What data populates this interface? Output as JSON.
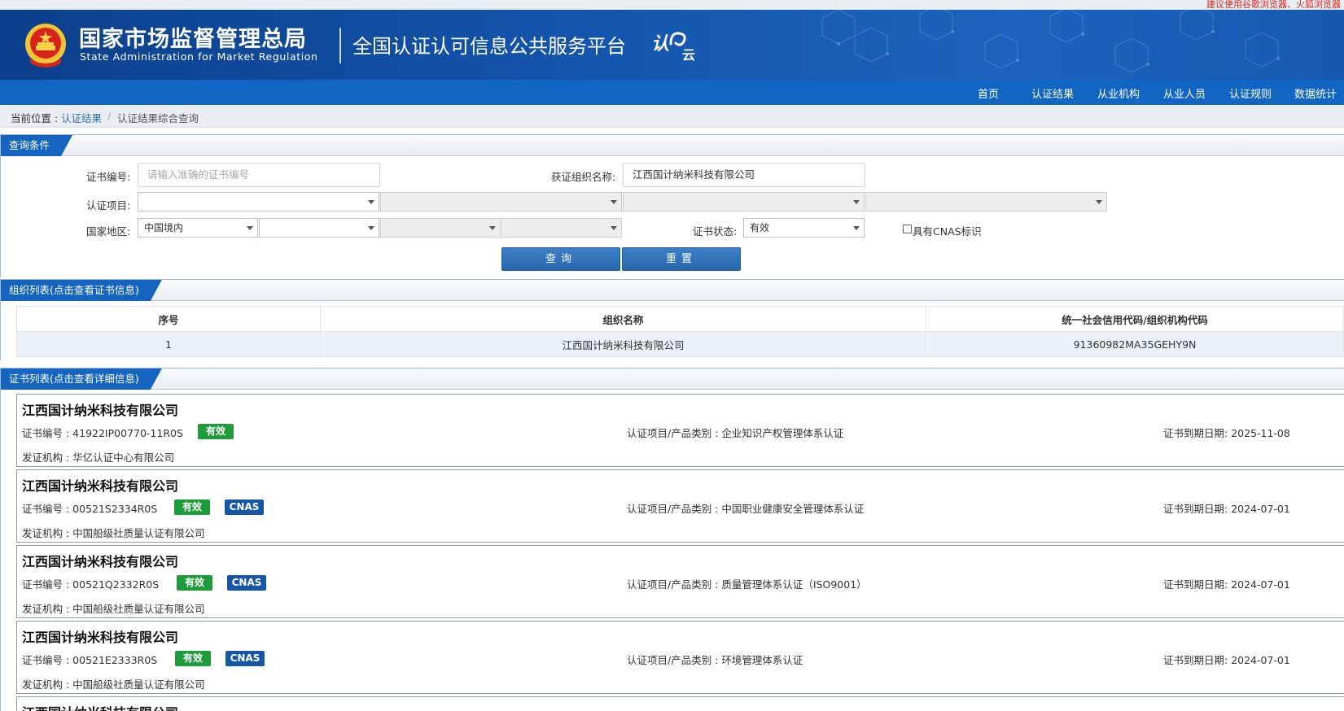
{
  "top_notice": "建议使用谷歌浏览器、火狐浏览器",
  "header": {
    "agency_cn": "国家市场监督管理总局",
    "agency_en": "State Administration  for  Market Regulation",
    "platform": "全国认证认可信息公共服务平台",
    "logo_text_1": "认",
    "logo_text_2": "云"
  },
  "nav": [
    "首页",
    "认证结果",
    "从业机构",
    "从业人员",
    "认证规则",
    "数据统计"
  ],
  "breadcrumb": {
    "prefix": "当前位置 : ",
    "link": "认证结果",
    "separator": "/",
    "current": "认证结果综合查询"
  },
  "query": {
    "section_title": "查询条件",
    "cert_no_label": "证书编号:",
    "cert_no_placeholder": "请输入准确的证书编号",
    "org_name_label": "获证组织名称:",
    "org_name_value": "江西国计纳米科技有限公司",
    "project_label": "认证项目:",
    "region_label": "国家地区:",
    "region_value": "中国境内",
    "status_label": "证书状态:",
    "status_value": "有效",
    "cnas_label": "具有CNAS标识",
    "search_button": "查询",
    "reset_button": "重置"
  },
  "org_list": {
    "section_title": "组织列表(点击查看证书信息)",
    "columns": [
      "序号",
      "组织名称",
      "统一社会信用代码/组织机构代码"
    ],
    "rows": [
      [
        "1",
        "江西国计纳米科技有限公司",
        "91360982MA35GEHY9N"
      ]
    ]
  },
  "cert_list": {
    "section_title": "证书列表(点击查看详细信息)",
    "cert_no_prefix": "证书编号 : ",
    "project_prefix": "认证项目/产品类别 : ",
    "expiry_prefix": "证书到期日期: ",
    "issuer_prefix": "发证机构 : ",
    "valid_badge": "有效",
    "cnas_badge": "CNAS",
    "items": [
      {
        "org": "江西国计纳米科技有限公司",
        "cert_no": "41922IP00770-11R0S",
        "cnas": false,
        "project": "企业知识产权管理体系认证",
        "expiry": "2025-11-08",
        "issuer": "华亿认证中心有限公司"
      },
      {
        "org": "江西国计纳米科技有限公司",
        "cert_no": "00521S2334R0S",
        "cnas": true,
        "project": "中国职业健康安全管理体系认证",
        "expiry": "2024-07-01",
        "issuer": "中国船级社质量认证有限公司"
      },
      {
        "org": "江西国计纳米科技有限公司",
        "cert_no": "00521Q2332R0S",
        "cnas": true,
        "project": "质量管理体系认证（ISO9001）",
        "expiry": "2024-07-01",
        "issuer": "中国船级社质量认证有限公司"
      },
      {
        "org": "江西国计纳米科技有限公司",
        "cert_no": "00521E2333R0S",
        "cnas": true,
        "project": "环境管理体系认证",
        "expiry": "2024-07-01",
        "issuer": "中国船级社质量认证有限公司"
      },
      {
        "org": "江西国计纳米科技有限公司"
      }
    ]
  }
}
